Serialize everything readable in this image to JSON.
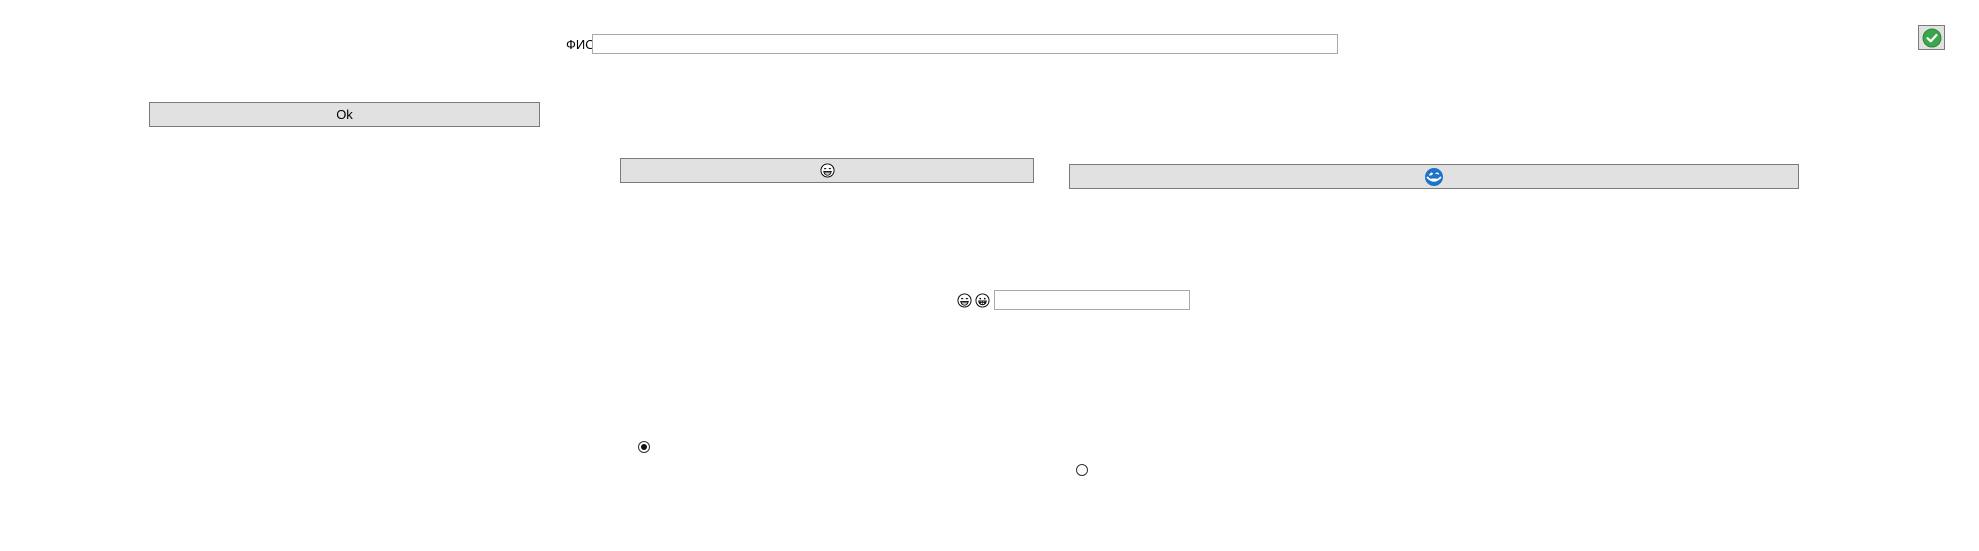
{
  "name_row": {
    "label": "ФИО",
    "value": ""
  },
  "confirm_tile": {
    "icon": "green-check-circle-icon",
    "color": "#3aa64a"
  },
  "ok_button": {
    "label": "Ok"
  },
  "emoji_button": {
    "icon": "laughing-face-icon"
  },
  "blue_icon_button": {
    "icon": "blue-face-icon",
    "color": "#1e73c8"
  },
  "emoji_row": {
    "icons": [
      "laughing-face-icon",
      "grinning-face-icon"
    ],
    "value": ""
  },
  "radios": [
    {
      "checked": true
    },
    {
      "checked": false
    }
  ]
}
